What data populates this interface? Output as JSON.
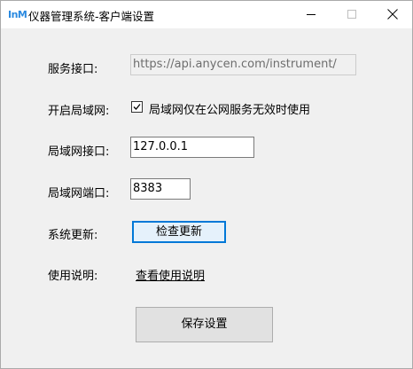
{
  "window": {
    "icon_text": "InM",
    "title": "仪器管理系统-客户端设置"
  },
  "form": {
    "service_port_label": "服务接口:",
    "service_port_value": "https://api.anycen.com/instrument/",
    "lan_enable_label": "开启局域网:",
    "lan_enable_checked": true,
    "lan_enable_text": "局域网仅在公网服务无效时使用",
    "lan_address_label": "局域网接口:",
    "lan_address_value": "127.0.0.1",
    "lan_port_label": "局域网端口:",
    "lan_port_value": "8383",
    "update_label": "系统更新:",
    "update_button": "检查更新",
    "help_label": "使用说明:",
    "help_link": "查看使用说明",
    "save_button": "保存设置"
  }
}
